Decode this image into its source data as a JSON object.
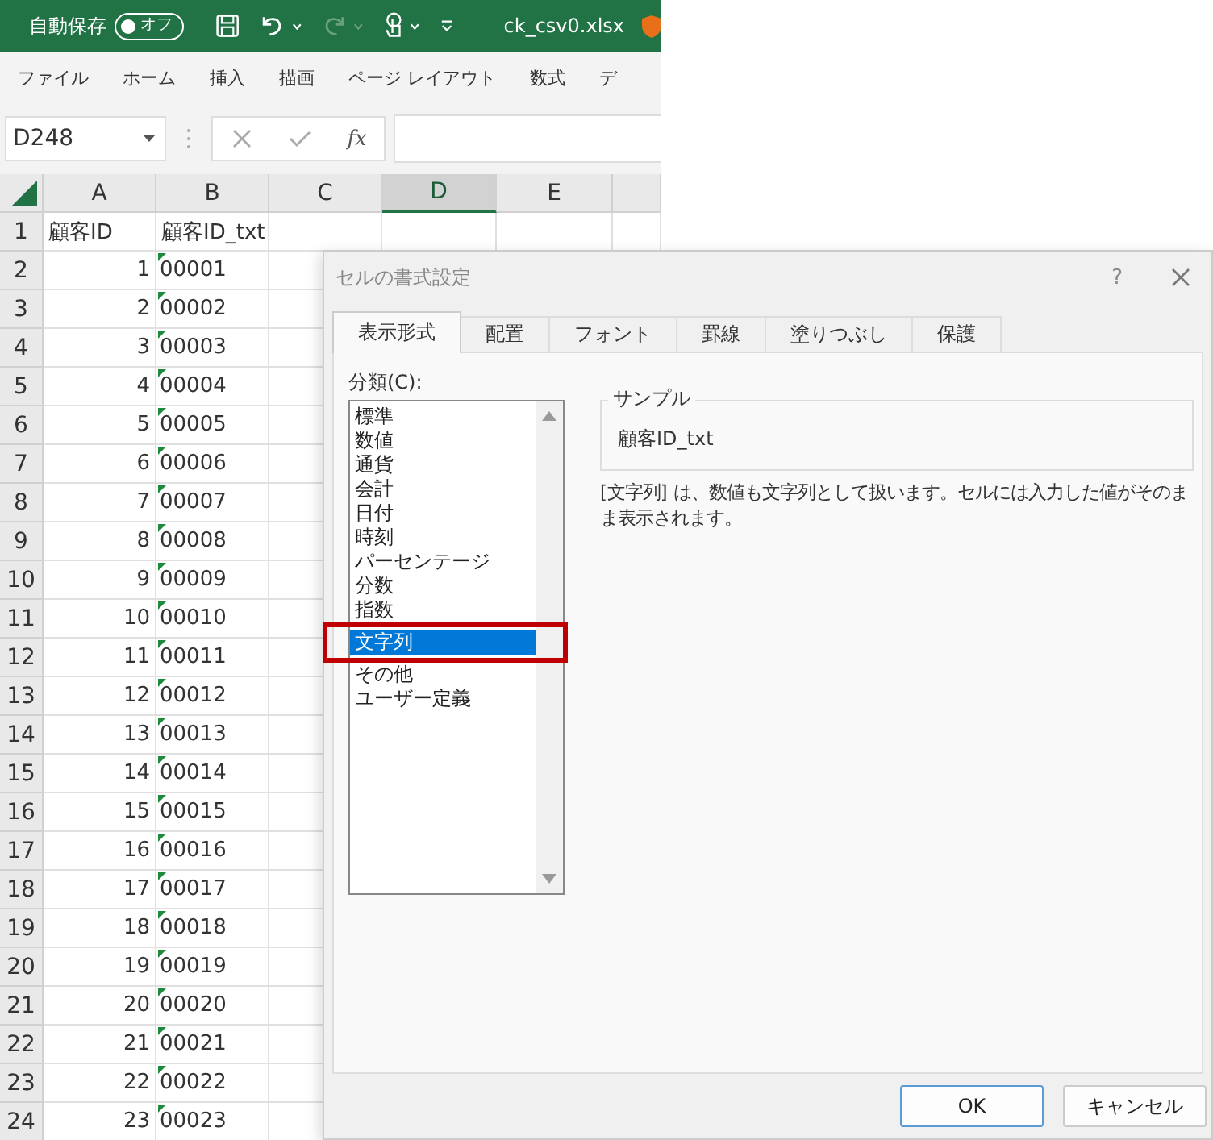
{
  "title_bar": {
    "autosave_label": "自動保存",
    "autosave_toggle": {
      "label": "オフ",
      "on": false
    },
    "filename": "ck_csv0.xlsx"
  },
  "menu": [
    "ファイル",
    "ホーム",
    "挿入",
    "描画",
    "ページ レイアウト",
    "数式",
    "デ"
  ],
  "formula_bar": {
    "name_box": "D248",
    "function_label": "fx"
  },
  "columns": [
    {
      "label": "A",
      "selected": false
    },
    {
      "label": "B",
      "selected": false
    },
    {
      "label": "C",
      "selected": false
    },
    {
      "label": "D",
      "selected": true
    },
    {
      "label": "E",
      "selected": false
    }
  ],
  "header_row": {
    "num": "1",
    "a": "顧客ID",
    "b": "顧客ID_txt"
  },
  "rows": [
    {
      "num": "2",
      "a": "1",
      "b": "00001",
      "b_flag": true
    },
    {
      "num": "3",
      "a": "2",
      "b": "00002",
      "b_flag": true
    },
    {
      "num": "4",
      "a": "3",
      "b": "00003",
      "b_flag": true
    },
    {
      "num": "5",
      "a": "4",
      "b": "00004",
      "b_flag": true
    },
    {
      "num": "6",
      "a": "5",
      "b": "00005",
      "b_flag": true
    },
    {
      "num": "7",
      "a": "6",
      "b": "00006",
      "b_flag": true
    },
    {
      "num": "8",
      "a": "7",
      "b": "00007",
      "b_flag": true
    },
    {
      "num": "9",
      "a": "8",
      "b": "00008",
      "b_flag": true
    },
    {
      "num": "10",
      "a": "9",
      "b": "00009",
      "b_flag": true
    },
    {
      "num": "11",
      "a": "10",
      "b": "00010",
      "b_flag": true
    },
    {
      "num": "12",
      "a": "11",
      "b": "00011",
      "b_flag": true
    },
    {
      "num": "13",
      "a": "12",
      "b": "00012",
      "b_flag": true
    },
    {
      "num": "14",
      "a": "13",
      "b": "00013",
      "b_flag": true
    },
    {
      "num": "15",
      "a": "14",
      "b": "00014",
      "b_flag": true
    },
    {
      "num": "16",
      "a": "15",
      "b": "00015",
      "b_flag": true
    },
    {
      "num": "17",
      "a": "16",
      "b": "00016",
      "b_flag": true
    },
    {
      "num": "18",
      "a": "17",
      "b": "00017",
      "b_flag": true
    },
    {
      "num": "19",
      "a": "18",
      "b": "00018",
      "b_flag": true
    },
    {
      "num": "20",
      "a": "19",
      "b": "00019",
      "b_flag": true
    },
    {
      "num": "21",
      "a": "20",
      "b": "00020",
      "b_flag": true
    },
    {
      "num": "22",
      "a": "21",
      "b": "00021",
      "b_flag": true
    },
    {
      "num": "23",
      "a": "22",
      "b": "00022",
      "b_flag": true
    },
    {
      "num": "24",
      "a": "23",
      "b": "00023",
      "b_flag": true
    }
  ],
  "dialog": {
    "title": "セルの書式設定",
    "help": "?",
    "tabs": [
      {
        "label": "表示形式",
        "selected": true
      },
      {
        "label": "配置",
        "selected": false
      },
      {
        "label": "フォント",
        "selected": false
      },
      {
        "label": "罫線",
        "selected": false
      },
      {
        "label": "塗りつぶし",
        "selected": false
      },
      {
        "label": "保護",
        "selected": false
      }
    ],
    "category_label": "分類(C):",
    "categories": [
      {
        "label": "標準",
        "selected": false
      },
      {
        "label": "数値",
        "selected": false
      },
      {
        "label": "通貨",
        "selected": false
      },
      {
        "label": "会計",
        "selected": false
      },
      {
        "label": "日付",
        "selected": false
      },
      {
        "label": "時刻",
        "selected": false
      },
      {
        "label": "パーセンテージ",
        "selected": false
      },
      {
        "label": "分数",
        "selected": false
      },
      {
        "label": "指数",
        "selected": false
      },
      {
        "label": "文字列",
        "selected": true
      },
      {
        "label": "その他",
        "selected": false
      },
      {
        "label": "ユーザー定義",
        "selected": false
      }
    ],
    "sample": {
      "legend": "サンプル",
      "value": "顧客ID_txt"
    },
    "description": "[文字列] は、数値も文字列として扱います。セルには入力した値がそのまま表示されます。",
    "buttons": [
      {
        "label": "OK",
        "default": true
      },
      {
        "label": "キャンセル",
        "default": false
      }
    ]
  }
}
